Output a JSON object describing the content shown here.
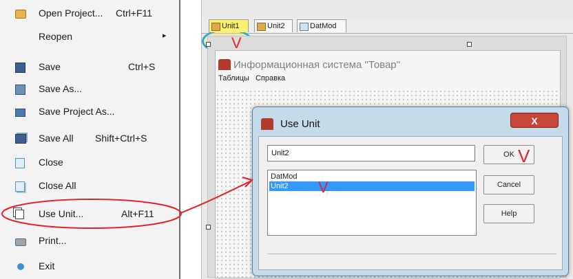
{
  "file_menu": {
    "items": [
      {
        "label": "Open Project...",
        "shortcut": "Ctrl+F11",
        "icon": "open-folder-icon"
      },
      {
        "label": "Reopen",
        "shortcut": "",
        "icon": "",
        "submenu_arrow": "▸"
      },
      {
        "label": "Save",
        "shortcut": "Ctrl+S",
        "icon": "floppy-disk-icon"
      },
      {
        "label": "Save As...",
        "shortcut": "",
        "icon": "floppy-disk-icon"
      },
      {
        "label": "Save Project As...",
        "shortcut": "",
        "icon": "project-icon"
      },
      {
        "label": "Save All",
        "shortcut": "Shift+Ctrl+S",
        "icon": "save-all-icon"
      },
      {
        "label": "Close",
        "shortcut": "",
        "icon": "close-file-icon"
      },
      {
        "label": "Close All",
        "shortcut": "",
        "icon": "close-all-icon"
      },
      {
        "label": "Use Unit...",
        "shortcut": "Alt+F11",
        "icon": "use-unit-icon"
      },
      {
        "label": "Print...",
        "shortcut": "",
        "icon": "printer-icon"
      },
      {
        "label": "Exit",
        "shortcut": "",
        "icon": "exit-icon"
      }
    ]
  },
  "editor_tabs": [
    {
      "label": "Unit1",
      "active": true
    },
    {
      "label": "Unit2",
      "active": false
    },
    {
      "label": "DatMod",
      "active": false
    }
  ],
  "designer_form": {
    "title": "Информационная система \"Товар\"",
    "menu": [
      "Таблицы",
      "Справка"
    ]
  },
  "use_unit_dialog": {
    "title": "Use Unit",
    "close_glyph": "X",
    "input_value": "Unit2",
    "list_items": [
      {
        "label": "DatMod",
        "selected": false
      },
      {
        "label": "Unit2",
        "selected": true
      }
    ],
    "buttons": {
      "ok": "OK",
      "cancel": "Cancel",
      "help": "Help"
    }
  },
  "annotations": {
    "highlight_color": "#e0242a",
    "tab_circle_color": "#2aa7d9",
    "check_marks": [
      "V",
      "V",
      "V"
    ]
  }
}
